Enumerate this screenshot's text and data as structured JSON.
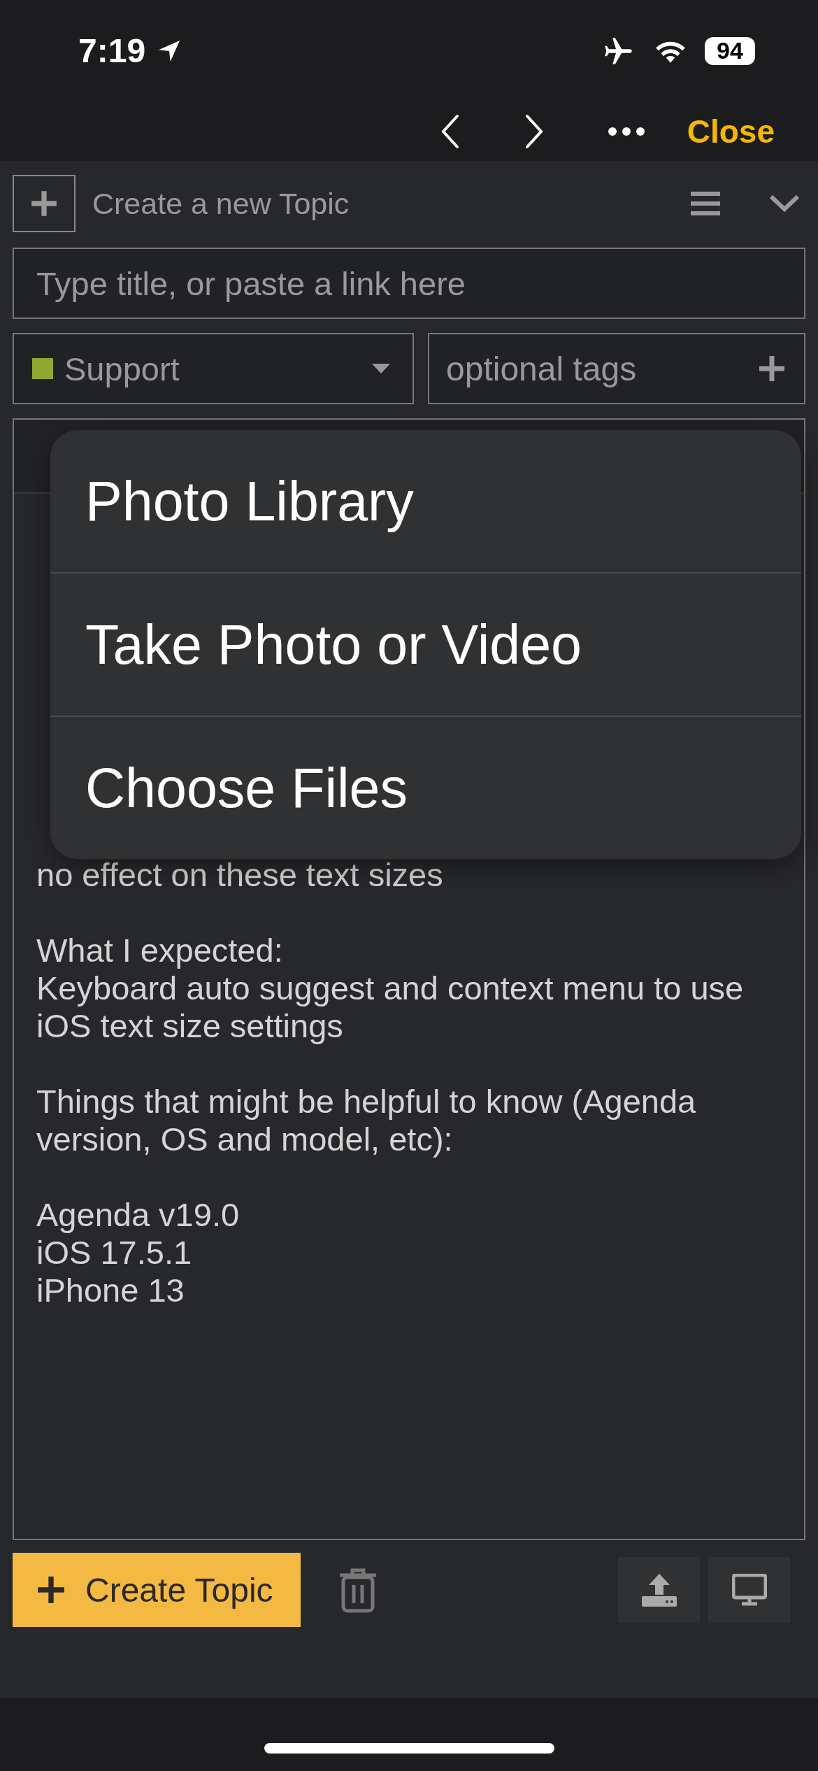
{
  "status_bar": {
    "time": "7:19",
    "battery": "94"
  },
  "nav_bar": {
    "close_label": "Close"
  },
  "composer": {
    "header": "Create a new Topic",
    "title_field": {
      "placeholder": "Type title, or paste a link here"
    },
    "category": {
      "label": "Support",
      "color": "#8fa832"
    },
    "tags_field": {
      "placeholder": "optional tags"
    },
    "editor": {
      "paragraphs": [
        [
          "no effect on these text sizes"
        ],
        [
          "What I expected:",
          "Keyboard auto suggest and context menu to use",
          "iOS text size settings"
        ],
        [
          "Things that might be helpful to know (Agenda",
          "version, OS and model, etc):"
        ],
        [
          "Agenda v19.0",
          "iOS 17.5.1",
          "iPhone 13"
        ]
      ]
    },
    "create_button": "Create Topic"
  },
  "attach_menu": {
    "items": [
      "Photo Library",
      "Take Photo or Video",
      "Choose Files"
    ]
  }
}
